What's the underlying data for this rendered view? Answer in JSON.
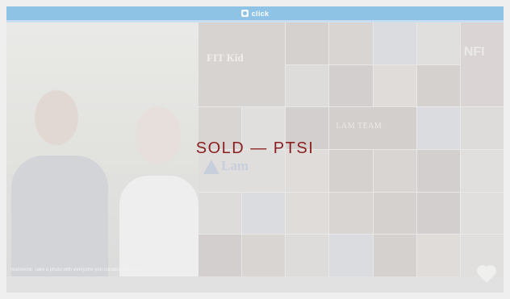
{
  "header": {
    "logo_icon": "click-logo-icon",
    "brand": "click"
  },
  "collage": {
    "tiles": [
      {
        "text": "FIT Kid"
      },
      {
        "text": "LAM TEAM"
      },
      {
        "text": "Lam"
      },
      {
        "text": "NFI"
      }
    ],
    "caption": "Teamwork: Take a photo with everyone you collaborated with in"
  },
  "overlay": {
    "sold_label": "SOLD — PTSI",
    "sold_color": "#8b1f1f"
  },
  "actions": {
    "heart_icon": "heart-icon"
  }
}
